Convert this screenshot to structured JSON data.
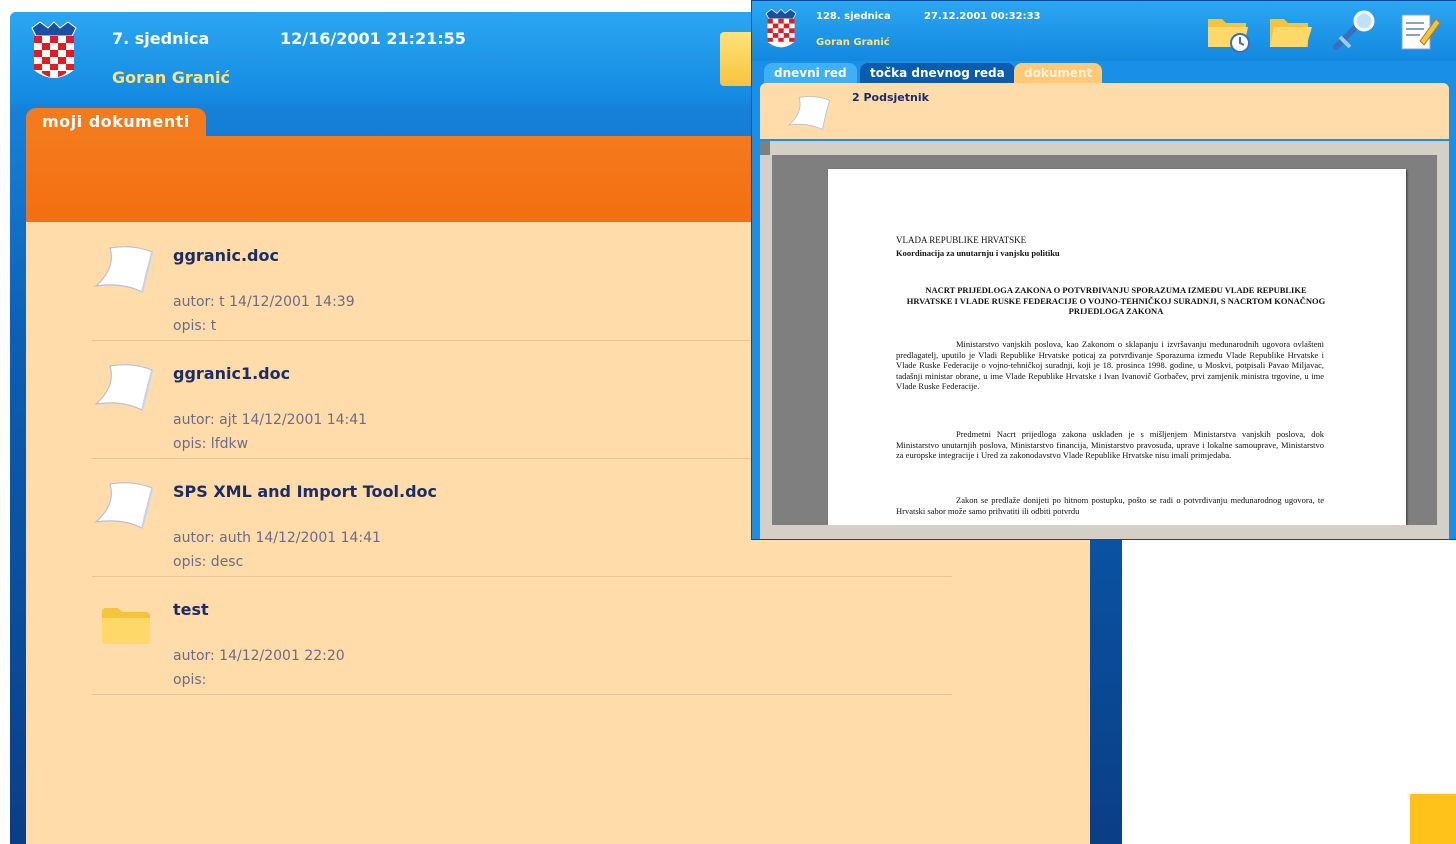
{
  "back_window": {
    "meeting": "7. sjednica",
    "datetime": "12/16/2001 21:21:55",
    "user": "Goran Granić",
    "tab": "moji dokumenti",
    "items": [
      {
        "name": "ggranic.doc",
        "author": "autor: t  14/12/2001   14:39",
        "desc": "opis: t",
        "type": "document"
      },
      {
        "name": "ggranic1.doc",
        "author": "autor: ajt  14/12/2001   14:41",
        "desc": "opis: lfdkw",
        "type": "document"
      },
      {
        "name": "SPS XML and Import Tool.doc",
        "author": "autor: auth  14/12/2001   14:41",
        "desc": "opis: desc",
        "type": "document"
      },
      {
        "name": "test",
        "author": "autor:    14/12/2001   22:20",
        "desc": "opis:",
        "type": "folder"
      }
    ]
  },
  "front_window": {
    "meeting": "128. sjednica",
    "datetime": "27.12.2001  00:32:33",
    "user": "Goran Granić",
    "tabs": [
      "dnevni red",
      "točka dnevnog reda",
      "dokument"
    ],
    "active_tab": "dokument",
    "doc_title": "2 Podsjetnik",
    "toolbar_icons": [
      "folder-clock-icon",
      "folder-open-icon",
      "search-tool-icon",
      "edit-document-icon"
    ],
    "document": {
      "heading1": "VLADA REPUBLIKE HRVATSKE",
      "heading2": "Koordinacija za unutarnju i vanjsku politiku",
      "title": "NACRT PRIJEDLOGA ZAKONA O POTVRĐIVANJU SPORAZUMA IZMEĐU VLADE REPUBLIKE HRVATSKE I VLADE RUSKE FEDERACIJE O VOJNO-TEHNIČKOJ SURADNJI, S NACRTOM KONAČNOG PRIJEDLOGA ZAKONA",
      "para1": "Ministarstvo vanjskih poslova, kao Zakonom o sklapanju i izvršavanju međunarodnih ugovora ovlašteni predlagatelj, uputilo je Vladi Republike Hrvatske poticaj za potvrđivanje Sporazuma između Vlade Republike Hrvatske i Vlade Ruske Federacije o vojno-tehničkoj suradnji, koji je 18. prosinca 1998. godine, u Moskvi, potpisali Pavao Miljavac, tadašnji ministar obrane, u ime Vlade Republike Hrvatske i Ivan Ivanovič Gorbačev, prvi zamjenik ministra trgovine, u ime Vlade Ruske Federacije.",
      "para2": "Predmetni Nacrt prijedloga zakona usklađen je s mišljenjem Ministarstva vanjskih poslova, dok Ministarstvo unutarnjih poslova, Ministarstvo financija, Ministarstvo pravosuđa, uprave i lokalne samouprave, Ministarstvo za europske integracije i Ured za zakonodavstvo Vlade Republike Hrvatske nisu imali primjedaba.",
      "para3": "Zakon se predlaže donijeti po hitnom postupku, pošto se radi o potvrđivanju međunarodnog ugovora, te Hrvatski sabor može samo prihvatiti ili odbiti potvrdu"
    }
  },
  "colors": {
    "blue_header": "#1a8fe8",
    "orange_tab": "#f47a1c",
    "peach_content": "#ffdcaa",
    "user_yellow": "#ffe27a",
    "item_title": "#1a2d66",
    "item_meta": "#6b6b8a"
  }
}
